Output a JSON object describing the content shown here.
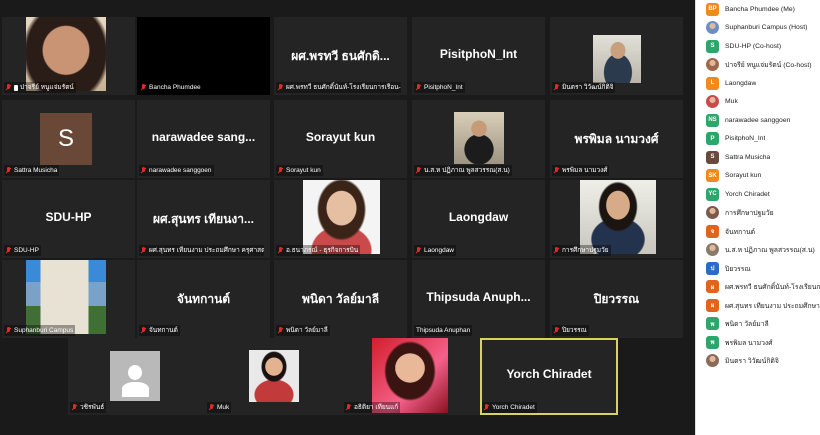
{
  "tiles": [
    {
      "id": "t1",
      "label": "ปาจรีย์ หนูแจ่มรัตน์",
      "muted": true,
      "pinned": true,
      "kind": "photo",
      "photo": "woman-selfie"
    },
    {
      "id": "t2",
      "label": "Bancha Phumdee",
      "muted": true,
      "kind": "black"
    },
    {
      "id": "t3",
      "label": "ผศ.พรทวี ธนศักดิ์นันท์-โรงเรียนการเรือน-วิท...",
      "bigname": "ผศ.พรทวี ธนศักดิ...",
      "muted": true,
      "kind": "name"
    },
    {
      "id": "t4",
      "label": "PisitphoN_Int",
      "bigname": "PisitphoN_Int",
      "muted": true,
      "kind": "name"
    },
    {
      "id": "t5",
      "label": "มินตรา วิวัฒน์กิติจิ",
      "muted": true,
      "kind": "photo",
      "photo": "man-standing"
    },
    {
      "id": "t6",
      "label": "Sattra Musicha",
      "muted": true,
      "kind": "avatar",
      "avatar": "S"
    },
    {
      "id": "t7",
      "label": "narawadee sanggoen",
      "bigname": "narawadee sang...",
      "muted": true,
      "kind": "name"
    },
    {
      "id": "t8",
      "label": "Sorayut kun",
      "bigname": "Sorayut kun",
      "muted": true,
      "kind": "name"
    },
    {
      "id": "t9",
      "label": "น.ส.ห ปฏิภาณ พูลสวรรณ(ส.น)",
      "muted": true,
      "kind": "photo",
      "photo": "man-sitting"
    },
    {
      "id": "t10",
      "label": "พรพิมล นามวงศ์",
      "bigname": "พรพิมล นามวงศ์",
      "muted": true,
      "kind": "name"
    },
    {
      "id": "t11",
      "label": "SDU-HP",
      "bigname": "SDU-HP",
      "muted": true,
      "kind": "name"
    },
    {
      "id": "t12",
      "label": "ผศ.สุนทร เทียนงาม ประถมศึกษา ครุศาสตร์",
      "bigname": "ผศ.สุนทร เทียนงา...",
      "muted": true,
      "kind": "name"
    },
    {
      "id": "t13",
      "label": "อ.ธนาภรณ์ - ธุรกิจการบิน",
      "muted": true,
      "kind": "photo",
      "photo": "woman-portrait"
    },
    {
      "id": "t14",
      "label": "Laongdaw",
      "bigname": "Laongdaw",
      "muted": true,
      "kind": "name"
    },
    {
      "id": "t15",
      "label": "การศึกษาปฐมวัย",
      "muted": true,
      "kind": "photo",
      "photo": "woman-desk"
    },
    {
      "id": "t16",
      "label": "Suphanburi Campus",
      "muted": true,
      "kind": "photo",
      "photo": "building"
    },
    {
      "id": "t17",
      "label": "จันทกานต์",
      "bigname": "จันทกานต์",
      "muted": true,
      "kind": "name"
    },
    {
      "id": "t18",
      "label": "พนิดา วัลย์มาลี",
      "bigname": "พนิดา วัลย์มาลี",
      "muted": true,
      "kind": "name"
    },
    {
      "id": "t19",
      "label": "Thipsuda Anuphan",
      "bigname": "Thipsuda  Anuph...",
      "muted": false,
      "kind": "name"
    },
    {
      "id": "t20",
      "label": "ปิยวรรณ",
      "bigname": "ปิยวรรณ",
      "muted": true,
      "kind": "name"
    },
    {
      "id": "t21",
      "label": "วชิรพันธ์",
      "muted": true,
      "kind": "person"
    },
    {
      "id": "t22",
      "label": "Muk",
      "muted": true,
      "kind": "photo",
      "photo": "person-red"
    },
    {
      "id": "t23",
      "label": "อธิติยา เทียนแก้",
      "muted": true,
      "kind": "photo",
      "photo": "woman-red"
    },
    {
      "id": "t24",
      "label": "Yorch Chiradet",
      "bigname": "Yorch Chiradet",
      "muted": true,
      "kind": "name",
      "active": true
    }
  ],
  "participants": [
    {
      "initials": "BP",
      "name": "Bancha Phumdee (Me)",
      "color": "#f08a1c"
    },
    {
      "initials": "S",
      "name": "Suphanburi Campus (Host)",
      "color": "#6b8fc4",
      "photo": true
    },
    {
      "initials": "S",
      "name": "SDU-HP (Co-host)",
      "color": "#2ea56b"
    },
    {
      "initials": "ป",
      "name": "ปาจรีย์ หนูแจ่มรัตน์ (Co-host)",
      "color": "#a0684a",
      "photo": true
    },
    {
      "initials": "L",
      "name": "Laongdaw",
      "color": "#f08a1c"
    },
    {
      "initials": "M",
      "name": "Muk",
      "color": "#c84a4a",
      "photo": true
    },
    {
      "initials": "NS",
      "name": "narawadee sanggoen",
      "color": "#2ea56b"
    },
    {
      "initials": "P",
      "name": "PisitphoN_Int",
      "color": "#2ea56b"
    },
    {
      "initials": "S",
      "name": "Sattra Musicha",
      "color": "#6a4a3a"
    },
    {
      "initials": "SK",
      "name": "Sorayut kun",
      "color": "#f08a1c"
    },
    {
      "initials": "YC",
      "name": "Yorch Chiradet",
      "color": "#2ea56b"
    },
    {
      "initials": "ก",
      "name": "การศึกษาปฐมวัย",
      "color": "#7a5a4a",
      "photo": true
    },
    {
      "initials": "จ",
      "name": "จันทกานต์",
      "color": "#e0641c"
    },
    {
      "initials": "น",
      "name": "น.ส.ห ปฏิภาณ พูลสวรรณ(ส.น)",
      "color": "#8a7a6a",
      "photo": true
    },
    {
      "initials": "ป",
      "name": "ปิยวรรณ",
      "color": "#2a6cc4"
    },
    {
      "initials": "ผ",
      "name": "ผศ.พรทวี ธนศักดิ์นันท์-โรงเรียนการ",
      "color": "#e0641c"
    },
    {
      "initials": "ผ",
      "name": "ผศ.สุนทร เทียนงาม ประถมศึกษา ครุ",
      "color": "#e0641c"
    },
    {
      "initials": "พ",
      "name": "พนิดา วัลย์มาลี",
      "color": "#2ea56b"
    },
    {
      "initials": "พ",
      "name": "พรพิมล นามวงศ์",
      "color": "#2ea56b"
    },
    {
      "initials": "ม",
      "name": "มินตรา วิวัฒน์กิติจิ",
      "color": "#8a6a5a",
      "photo": true
    }
  ]
}
